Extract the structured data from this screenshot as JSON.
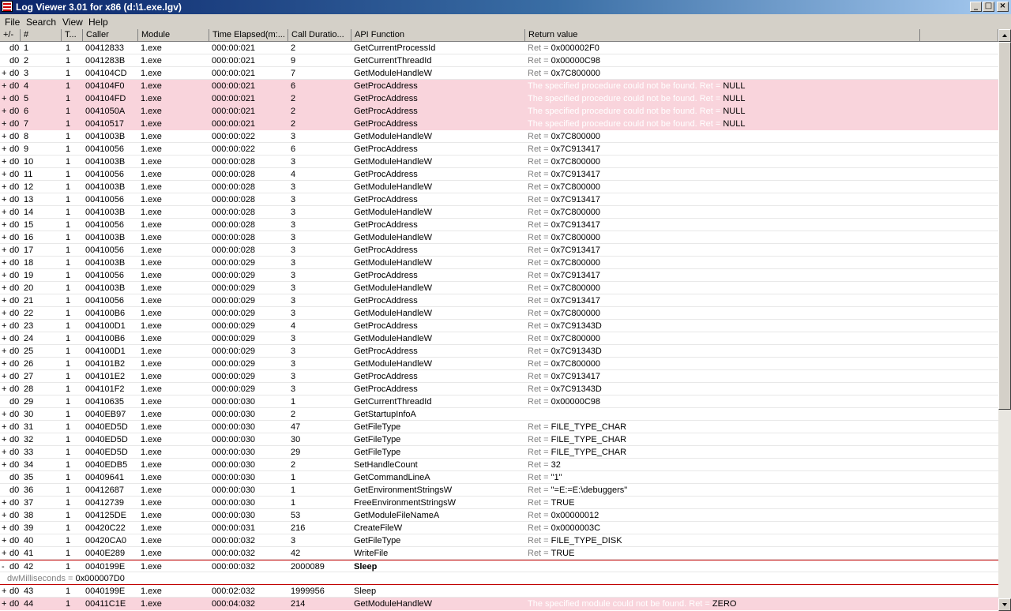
{
  "window": {
    "title": "Log Viewer 3.01 for x86 (d:\\1.exe.lgv)",
    "controls": [
      "_",
      "□",
      "×"
    ]
  },
  "menu": [
    "File",
    "Search",
    "View",
    "Help"
  ],
  "columns": [
    "+/-",
    "#",
    "T...",
    "Caller",
    "Module",
    "Time Elapsed(m:...",
    "Call Duratio...",
    "API Function",
    "Return value"
  ],
  "rows": [
    {
      "pm": "",
      "d": "d0",
      "num": "1",
      "t": "1",
      "caller": "00412833",
      "module": "1.exe",
      "time": "000:00:021",
      "dur": "2",
      "api": "GetCurrentProcessId",
      "ret_msg": "",
      "ret_pre": "Ret = ",
      "ret_val": "0x000002F0",
      "error": false
    },
    {
      "pm": "",
      "d": "d0",
      "num": "2",
      "t": "1",
      "caller": "0041283B",
      "module": "1.exe",
      "time": "000:00:021",
      "dur": "9",
      "api": "GetCurrentThreadId",
      "ret_msg": "",
      "ret_pre": "Ret = ",
      "ret_val": "0x00000C98",
      "error": false
    },
    {
      "pm": "+",
      "d": "d0",
      "num": "3",
      "t": "1",
      "caller": "004104CD",
      "module": "1.exe",
      "time": "000:00:021",
      "dur": "7",
      "api": "GetModuleHandleW",
      "ret_msg": "",
      "ret_pre": "Ret = ",
      "ret_val": "0x7C800000",
      "error": false
    },
    {
      "pm": "+",
      "d": "d0",
      "num": "4",
      "t": "1",
      "caller": "004104F0",
      "module": "1.exe",
      "time": "000:00:021",
      "dur": "6",
      "api": "GetProcAddress",
      "ret_msg": "The specified procedure could not be found. ",
      "ret_pre": "Ret = ",
      "ret_val": "NULL",
      "error": true
    },
    {
      "pm": "+",
      "d": "d0",
      "num": "5",
      "t": "1",
      "caller": "004104FD",
      "module": "1.exe",
      "time": "000:00:021",
      "dur": "2",
      "api": "GetProcAddress",
      "ret_msg": "The specified procedure could not be found. ",
      "ret_pre": "Ret = ",
      "ret_val": "NULL",
      "error": true
    },
    {
      "pm": "+",
      "d": "d0",
      "num": "6",
      "t": "1",
      "caller": "0041050A",
      "module": "1.exe",
      "time": "000:00:021",
      "dur": "2",
      "api": "GetProcAddress",
      "ret_msg": "The specified procedure could not be found. ",
      "ret_pre": "Ret = ",
      "ret_val": "NULL",
      "error": true
    },
    {
      "pm": "+",
      "d": "d0",
      "num": "7",
      "t": "1",
      "caller": "00410517",
      "module": "1.exe",
      "time": "000:00:021",
      "dur": "2",
      "api": "GetProcAddress",
      "ret_msg": "The specified procedure could not be found. ",
      "ret_pre": "Ret = ",
      "ret_val": "NULL",
      "error": true
    },
    {
      "pm": "+",
      "d": "d0",
      "num": "8",
      "t": "1",
      "caller": "0041003B",
      "module": "1.exe",
      "time": "000:00:022",
      "dur": "3",
      "api": "GetModuleHandleW",
      "ret_msg": "",
      "ret_pre": "Ret = ",
      "ret_val": "0x7C800000",
      "error": false
    },
    {
      "pm": "+",
      "d": "d0",
      "num": "9",
      "t": "1",
      "caller": "00410056",
      "module": "1.exe",
      "time": "000:00:022",
      "dur": "6",
      "api": "GetProcAddress",
      "ret_msg": "",
      "ret_pre": "Ret = ",
      "ret_val": "0x7C913417",
      "error": false
    },
    {
      "pm": "+",
      "d": "d0",
      "num": "10",
      "t": "1",
      "caller": "0041003B",
      "module": "1.exe",
      "time": "000:00:028",
      "dur": "3",
      "api": "GetModuleHandleW",
      "ret_msg": "",
      "ret_pre": "Ret = ",
      "ret_val": "0x7C800000",
      "error": false
    },
    {
      "pm": "+",
      "d": "d0",
      "num": "11",
      "t": "1",
      "caller": "00410056",
      "module": "1.exe",
      "time": "000:00:028",
      "dur": "4",
      "api": "GetProcAddress",
      "ret_msg": "",
      "ret_pre": "Ret = ",
      "ret_val": "0x7C913417",
      "error": false
    },
    {
      "pm": "+",
      "d": "d0",
      "num": "12",
      "t": "1",
      "caller": "0041003B",
      "module": "1.exe",
      "time": "000:00:028",
      "dur": "3",
      "api": "GetModuleHandleW",
      "ret_msg": "",
      "ret_pre": "Ret = ",
      "ret_val": "0x7C800000",
      "error": false
    },
    {
      "pm": "+",
      "d": "d0",
      "num": "13",
      "t": "1",
      "caller": "00410056",
      "module": "1.exe",
      "time": "000:00:028",
      "dur": "3",
      "api": "GetProcAddress",
      "ret_msg": "",
      "ret_pre": "Ret = ",
      "ret_val": "0x7C913417",
      "error": false
    },
    {
      "pm": "+",
      "d": "d0",
      "num": "14",
      "t": "1",
      "caller": "0041003B",
      "module": "1.exe",
      "time": "000:00:028",
      "dur": "3",
      "api": "GetModuleHandleW",
      "ret_msg": "",
      "ret_pre": "Ret = ",
      "ret_val": "0x7C800000",
      "error": false
    },
    {
      "pm": "+",
      "d": "d0",
      "num": "15",
      "t": "1",
      "caller": "00410056",
      "module": "1.exe",
      "time": "000:00:028",
      "dur": "3",
      "api": "GetProcAddress",
      "ret_msg": "",
      "ret_pre": "Ret = ",
      "ret_val": "0x7C913417",
      "error": false
    },
    {
      "pm": "+",
      "d": "d0",
      "num": "16",
      "t": "1",
      "caller": "0041003B",
      "module": "1.exe",
      "time": "000:00:028",
      "dur": "3",
      "api": "GetModuleHandleW",
      "ret_msg": "",
      "ret_pre": "Ret = ",
      "ret_val": "0x7C800000",
      "error": false
    },
    {
      "pm": "+",
      "d": "d0",
      "num": "17",
      "t": "1",
      "caller": "00410056",
      "module": "1.exe",
      "time": "000:00:028",
      "dur": "3",
      "api": "GetProcAddress",
      "ret_msg": "",
      "ret_pre": "Ret = ",
      "ret_val": "0x7C913417",
      "error": false
    },
    {
      "pm": "+",
      "d": "d0",
      "num": "18",
      "t": "1",
      "caller": "0041003B",
      "module": "1.exe",
      "time": "000:00:029",
      "dur": "3",
      "api": "GetModuleHandleW",
      "ret_msg": "",
      "ret_pre": "Ret = ",
      "ret_val": "0x7C800000",
      "error": false
    },
    {
      "pm": "+",
      "d": "d0",
      "num": "19",
      "t": "1",
      "caller": "00410056",
      "module": "1.exe",
      "time": "000:00:029",
      "dur": "3",
      "api": "GetProcAddress",
      "ret_msg": "",
      "ret_pre": "Ret = ",
      "ret_val": "0x7C913417",
      "error": false
    },
    {
      "pm": "+",
      "d": "d0",
      "num": "20",
      "t": "1",
      "caller": "0041003B",
      "module": "1.exe",
      "time": "000:00:029",
      "dur": "3",
      "api": "GetModuleHandleW",
      "ret_msg": "",
      "ret_pre": "Ret = ",
      "ret_val": "0x7C800000",
      "error": false
    },
    {
      "pm": "+",
      "d": "d0",
      "num": "21",
      "t": "1",
      "caller": "00410056",
      "module": "1.exe",
      "time": "000:00:029",
      "dur": "3",
      "api": "GetProcAddress",
      "ret_msg": "",
      "ret_pre": "Ret = ",
      "ret_val": "0x7C913417",
      "error": false
    },
    {
      "pm": "+",
      "d": "d0",
      "num": "22",
      "t": "1",
      "caller": "004100B6",
      "module": "1.exe",
      "time": "000:00:029",
      "dur": "3",
      "api": "GetModuleHandleW",
      "ret_msg": "",
      "ret_pre": "Ret = ",
      "ret_val": "0x7C800000",
      "error": false
    },
    {
      "pm": "+",
      "d": "d0",
      "num": "23",
      "t": "1",
      "caller": "004100D1",
      "module": "1.exe",
      "time": "000:00:029",
      "dur": "4",
      "api": "GetProcAddress",
      "ret_msg": "",
      "ret_pre": "Ret = ",
      "ret_val": "0x7C91343D",
      "error": false
    },
    {
      "pm": "+",
      "d": "d0",
      "num": "24",
      "t": "1",
      "caller": "004100B6",
      "module": "1.exe",
      "time": "000:00:029",
      "dur": "3",
      "api": "GetModuleHandleW",
      "ret_msg": "",
      "ret_pre": "Ret = ",
      "ret_val": "0x7C800000",
      "error": false
    },
    {
      "pm": "+",
      "d": "d0",
      "num": "25",
      "t": "1",
      "caller": "004100D1",
      "module": "1.exe",
      "time": "000:00:029",
      "dur": "3",
      "api": "GetProcAddress",
      "ret_msg": "",
      "ret_pre": "Ret = ",
      "ret_val": "0x7C91343D",
      "error": false
    },
    {
      "pm": "+",
      "d": "d0",
      "num": "26",
      "t": "1",
      "caller": "004101B2",
      "module": "1.exe",
      "time": "000:00:029",
      "dur": "3",
      "api": "GetModuleHandleW",
      "ret_msg": "",
      "ret_pre": "Ret = ",
      "ret_val": "0x7C800000",
      "error": false
    },
    {
      "pm": "+",
      "d": "d0",
      "num": "27",
      "t": "1",
      "caller": "004101E2",
      "module": "1.exe",
      "time": "000:00:029",
      "dur": "3",
      "api": "GetProcAddress",
      "ret_msg": "",
      "ret_pre": "Ret = ",
      "ret_val": "0x7C913417",
      "error": false
    },
    {
      "pm": "+",
      "d": "d0",
      "num": "28",
      "t": "1",
      "caller": "004101F2",
      "module": "1.exe",
      "time": "000:00:029",
      "dur": "3",
      "api": "GetProcAddress",
      "ret_msg": "",
      "ret_pre": "Ret = ",
      "ret_val": "0x7C91343D",
      "error": false
    },
    {
      "pm": "",
      "d": "d0",
      "num": "29",
      "t": "1",
      "caller": "00410635",
      "module": "1.exe",
      "time": "000:00:030",
      "dur": "1",
      "api": "GetCurrentThreadId",
      "ret_msg": "",
      "ret_pre": "Ret = ",
      "ret_val": "0x00000C98",
      "error": false
    },
    {
      "pm": "+",
      "d": "d0",
      "num": "30",
      "t": "1",
      "caller": "0040EB97",
      "module": "1.exe",
      "time": "000:00:030",
      "dur": "2",
      "api": "GetStartupInfoA",
      "ret_msg": "",
      "ret_pre": "",
      "ret_val": "",
      "error": false
    },
    {
      "pm": "+",
      "d": "d0",
      "num": "31",
      "t": "1",
      "caller": "0040ED5D",
      "module": "1.exe",
      "time": "000:00:030",
      "dur": "47",
      "api": "GetFileType",
      "ret_msg": "",
      "ret_pre": "Ret = ",
      "ret_val": "FILE_TYPE_CHAR",
      "error": false
    },
    {
      "pm": "+",
      "d": "d0",
      "num": "32",
      "t": "1",
      "caller": "0040ED5D",
      "module": "1.exe",
      "time": "000:00:030",
      "dur": "30",
      "api": "GetFileType",
      "ret_msg": "",
      "ret_pre": "Ret = ",
      "ret_val": "FILE_TYPE_CHAR",
      "error": false
    },
    {
      "pm": "+",
      "d": "d0",
      "num": "33",
      "t": "1",
      "caller": "0040ED5D",
      "module": "1.exe",
      "time": "000:00:030",
      "dur": "29",
      "api": "GetFileType",
      "ret_msg": "",
      "ret_pre": "Ret = ",
      "ret_val": "FILE_TYPE_CHAR",
      "error": false
    },
    {
      "pm": "+",
      "d": "d0",
      "num": "34",
      "t": "1",
      "caller": "0040EDB5",
      "module": "1.exe",
      "time": "000:00:030",
      "dur": "2",
      "api": "SetHandleCount",
      "ret_msg": "",
      "ret_pre": "Ret = ",
      "ret_val": "32",
      "error": false
    },
    {
      "pm": "",
      "d": "d0",
      "num": "35",
      "t": "1",
      "caller": "00409641",
      "module": "1.exe",
      "time": "000:00:030",
      "dur": "1",
      "api": "GetCommandLineA",
      "ret_msg": "",
      "ret_pre": "Ret = ",
      "ret_val": "\"1\"",
      "error": false
    },
    {
      "pm": "",
      "d": "d0",
      "num": "36",
      "t": "1",
      "caller": "00412687",
      "module": "1.exe",
      "time": "000:00:030",
      "dur": "1",
      "api": "GetEnvironmentStringsW",
      "ret_msg": "",
      "ret_pre": "Ret = ",
      "ret_val": "\"=E:=E:\\debuggers\"",
      "error": false
    },
    {
      "pm": "+",
      "d": "d0",
      "num": "37",
      "t": "1",
      "caller": "00412739",
      "module": "1.exe",
      "time": "000:00:030",
      "dur": "1",
      "api": "FreeEnvironmentStringsW",
      "ret_msg": "",
      "ret_pre": "Ret = ",
      "ret_val": "TRUE",
      "error": false
    },
    {
      "pm": "+",
      "d": "d0",
      "num": "38",
      "t": "1",
      "caller": "004125DE",
      "module": "1.exe",
      "time": "000:00:030",
      "dur": "53",
      "api": "GetModuleFileNameA",
      "ret_msg": "",
      "ret_pre": "Ret = ",
      "ret_val": "0x00000012",
      "error": false
    },
    {
      "pm": "+",
      "d": "d0",
      "num": "39",
      "t": "1",
      "caller": "00420C22",
      "module": "1.exe",
      "time": "000:00:031",
      "dur": "216",
      "api": "CreateFileW",
      "ret_msg": "",
      "ret_pre": "Ret = ",
      "ret_val": "0x0000003C",
      "error": false
    },
    {
      "pm": "+",
      "d": "d0",
      "num": "40",
      "t": "1",
      "caller": "00420CA0",
      "module": "1.exe",
      "time": "000:00:032",
      "dur": "3",
      "api": "GetFileType",
      "ret_msg": "",
      "ret_pre": "Ret = ",
      "ret_val": "FILE_TYPE_DISK",
      "error": false
    },
    {
      "pm": "+",
      "d": "d0",
      "num": "41",
      "t": "1",
      "caller": "0040E289",
      "module": "1.exe",
      "time": "000:00:032",
      "dur": "42",
      "api": "WriteFile",
      "ret_msg": "",
      "ret_pre": "Ret = ",
      "ret_val": "TRUE",
      "error": false
    }
  ],
  "selected": {
    "pm": "-",
    "d": "d0",
    "num": "42",
    "t": "1",
    "caller": "0040199E",
    "module": "1.exe",
    "time": "000:00:032",
    "dur": "2000089",
    "api": "Sleep",
    "param_name": "dwMilliseconds = ",
    "param_val": "0x000007D0"
  },
  "tail_rows": [
    {
      "pm": "+",
      "d": "d0",
      "num": "43",
      "t": "1",
      "caller": "0040199E",
      "module": "1.exe",
      "time": "000:02:032",
      "dur": "1999956",
      "api": "Sleep",
      "ret_msg": "",
      "ret_pre": "",
      "ret_val": "",
      "error": false
    },
    {
      "pm": "+",
      "d": "d0",
      "num": "44",
      "t": "1",
      "caller": "00411C1E",
      "module": "1.exe",
      "time": "000:04:032",
      "dur": "214",
      "api": "GetModuleHandleW",
      "ret_msg": "The specified module could not be found. ",
      "ret_pre": "Ret = ",
      "ret_val": "ZERO",
      "error": true
    }
  ],
  "colors": {
    "error_row": "#f9d4dc",
    "selection_border": "#c00000",
    "title_gradient_start": "#0a246a"
  }
}
